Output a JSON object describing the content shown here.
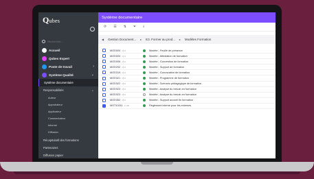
{
  "brand": {
    "logo": "Q",
    "logo_rest": "ubes"
  },
  "icons": {
    "settings": "settings-icon",
    "search": "search-icon"
  },
  "sidebar": {
    "search_placeholder": "Recherche...",
    "main_items": [
      {
        "label": "Accueil",
        "color": "#ffffff"
      },
      {
        "label": "Qubes Expert",
        "color": "#e040fb"
      },
      {
        "label": "Poste de travail",
        "color": "#2196f3"
      },
      {
        "label": "Système Qualité",
        "color": "#7c4dff"
      }
    ],
    "active_item": "Système documentaire",
    "responsabilites": "Responsabilités",
    "roles": [
      "Auteur",
      "Approbateur",
      "Applicateur",
      "Commentateur",
      "Informé",
      "Diffusion"
    ],
    "lower_items": [
      "Récapitulatif des formations",
      "Partenaires",
      "Diffusion papier"
    ]
  },
  "header": {
    "title": "Système documentaire"
  },
  "breadcrumb": [
    "Gestion Document...",
    "E3. Former au prod...",
    "Modèles Formation"
  ],
  "documents": [
    {
      "code": "MOD004",
      "version": "v6.0",
      "title": "Modèle - Feuille de présence",
      "status": "approved",
      "icon": "outline"
    },
    {
      "code": "MOD004",
      "version": "v2.0",
      "title": "Modèle - Attestation de formation",
      "status": "approved",
      "icon": "outline"
    },
    {
      "code": "MOD006",
      "version": "v5.0",
      "title": "Modèle - Convention de formation",
      "status": "approved",
      "icon": "outline"
    },
    {
      "code": "MOD202",
      "version": "v6.0",
      "title": "Modèle - Support de formation",
      "status": "approved",
      "icon": "outline"
    },
    {
      "code": "MOD319",
      "version": "v6.0",
      "title": "Modèle - Convocation de formation",
      "status": "approved",
      "icon": "outline"
    },
    {
      "code": "MOD321",
      "version": "v6.0",
      "title": "Modèle - Programme de formation",
      "status": "approved",
      "icon": "outline"
    },
    {
      "code": "MOD322",
      "version": "v6.0",
      "title": "Modèle - Scénario pédagogique de formation",
      "status": "approved",
      "icon": "outline"
    },
    {
      "code": "MOD323",
      "version": "v6.0",
      "title": "Modèle - Analyse du besoin en formation",
      "status": "approved",
      "icon": "outline"
    },
    {
      "code": "MOD323",
      "version": "v6.0",
      "title": "Modèle - Analyse du besoin en formation",
      "status": "pending",
      "icon": "outline"
    },
    {
      "code": "MOD352",
      "version": "v6.0",
      "title": "Modèle - Support accueil fin formation",
      "status": "approved",
      "icon": "outline"
    },
    {
      "code": "MOT10011",
      "version": "v1.00",
      "title": "Règlement interne pour les externes",
      "status": "approved",
      "icon": "filled"
    }
  ]
}
